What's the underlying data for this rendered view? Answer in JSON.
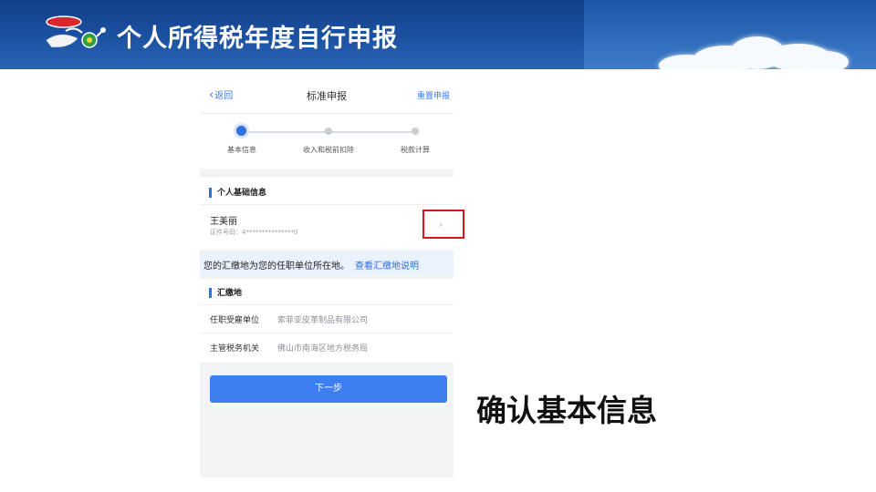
{
  "slide": {
    "title": "个人所得税年度自行申报",
    "caption": "确认基本信息",
    "colors": {
      "banner": "#1a4e9e",
      "highlight": "#d9141b",
      "accent": "#2f6fde"
    }
  },
  "phone": {
    "nav": {
      "back": "返回",
      "title": "标准申报",
      "reset": "重置申报"
    },
    "steps": [
      {
        "label": "基本信息",
        "active": true
      },
      {
        "label": "收入和税前扣除",
        "active": false
      },
      {
        "label": "税款计算",
        "active": false
      }
    ],
    "basic_info": {
      "section_title": "个人基础信息",
      "name": "王美丽",
      "id_label": "证件号码：",
      "id_value": "4***************0",
      "arrow_icon": "chevron-right-icon"
    },
    "notice": {
      "text": "您的汇缴地为您的任职单位所在地。",
      "link": "查看汇缴地说明"
    },
    "payment_place": {
      "section_title": "汇缴地",
      "rows": [
        {
          "label": "任职受雇单位",
          "value": "索菲亚皮革制品有限公司"
        },
        {
          "label": "主管税务机关",
          "value": "佛山市南海区地方税务局"
        }
      ]
    },
    "next_button": "下一步"
  }
}
